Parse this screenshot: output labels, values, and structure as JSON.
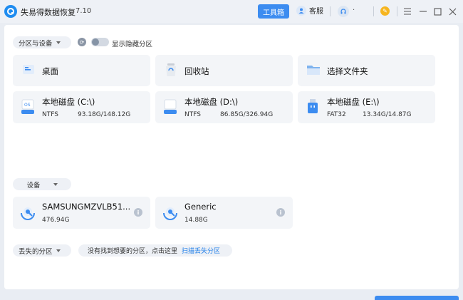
{
  "titlebar": {
    "app_title": "失易得数据恢复",
    "version": "7.10",
    "toolbox_label": "工具箱",
    "customer_service_label": "客服",
    "user_dot": "·"
  },
  "controls": {
    "partitions_label": "分区与设备",
    "show_hidden_label": "显示隐藏分区",
    "show_hidden_on": false
  },
  "locations": [
    {
      "label": "桌面",
      "icon": "desktop-icon"
    },
    {
      "label": "回收站",
      "icon": "recycle-bin-icon"
    },
    {
      "label": "选择文件夹",
      "icon": "folder-icon"
    }
  ],
  "disks": [
    {
      "label": "本地磁盘 (C:\\)",
      "fs": "NTFS",
      "usage": "93.18G/148.12G",
      "icon": "os-disk-icon"
    },
    {
      "label": "本地磁盘 (D:\\)",
      "fs": "NTFS",
      "usage": "86.85G/326.94G",
      "icon": "disk-icon"
    },
    {
      "label": "本地磁盘 (E:\\)",
      "fs": "FAT32",
      "usage": "13.34G/14.87G",
      "icon": "usb-disk-icon"
    }
  ],
  "devices_section": {
    "label": "设备",
    "devices": [
      {
        "label": "SAMSUNGMZVLB51...",
        "size": "476.94G"
      },
      {
        "label": "Generic",
        "size": "14.88G"
      }
    ]
  },
  "lost_section": {
    "label": "丢失的分区",
    "message": "没有找到想要的分区，点击这里",
    "link": "扫描丢失分区"
  },
  "colors": {
    "accent": "#3c8cf0",
    "link": "#1f7ee8",
    "card_bg": "#f3f5f8"
  }
}
